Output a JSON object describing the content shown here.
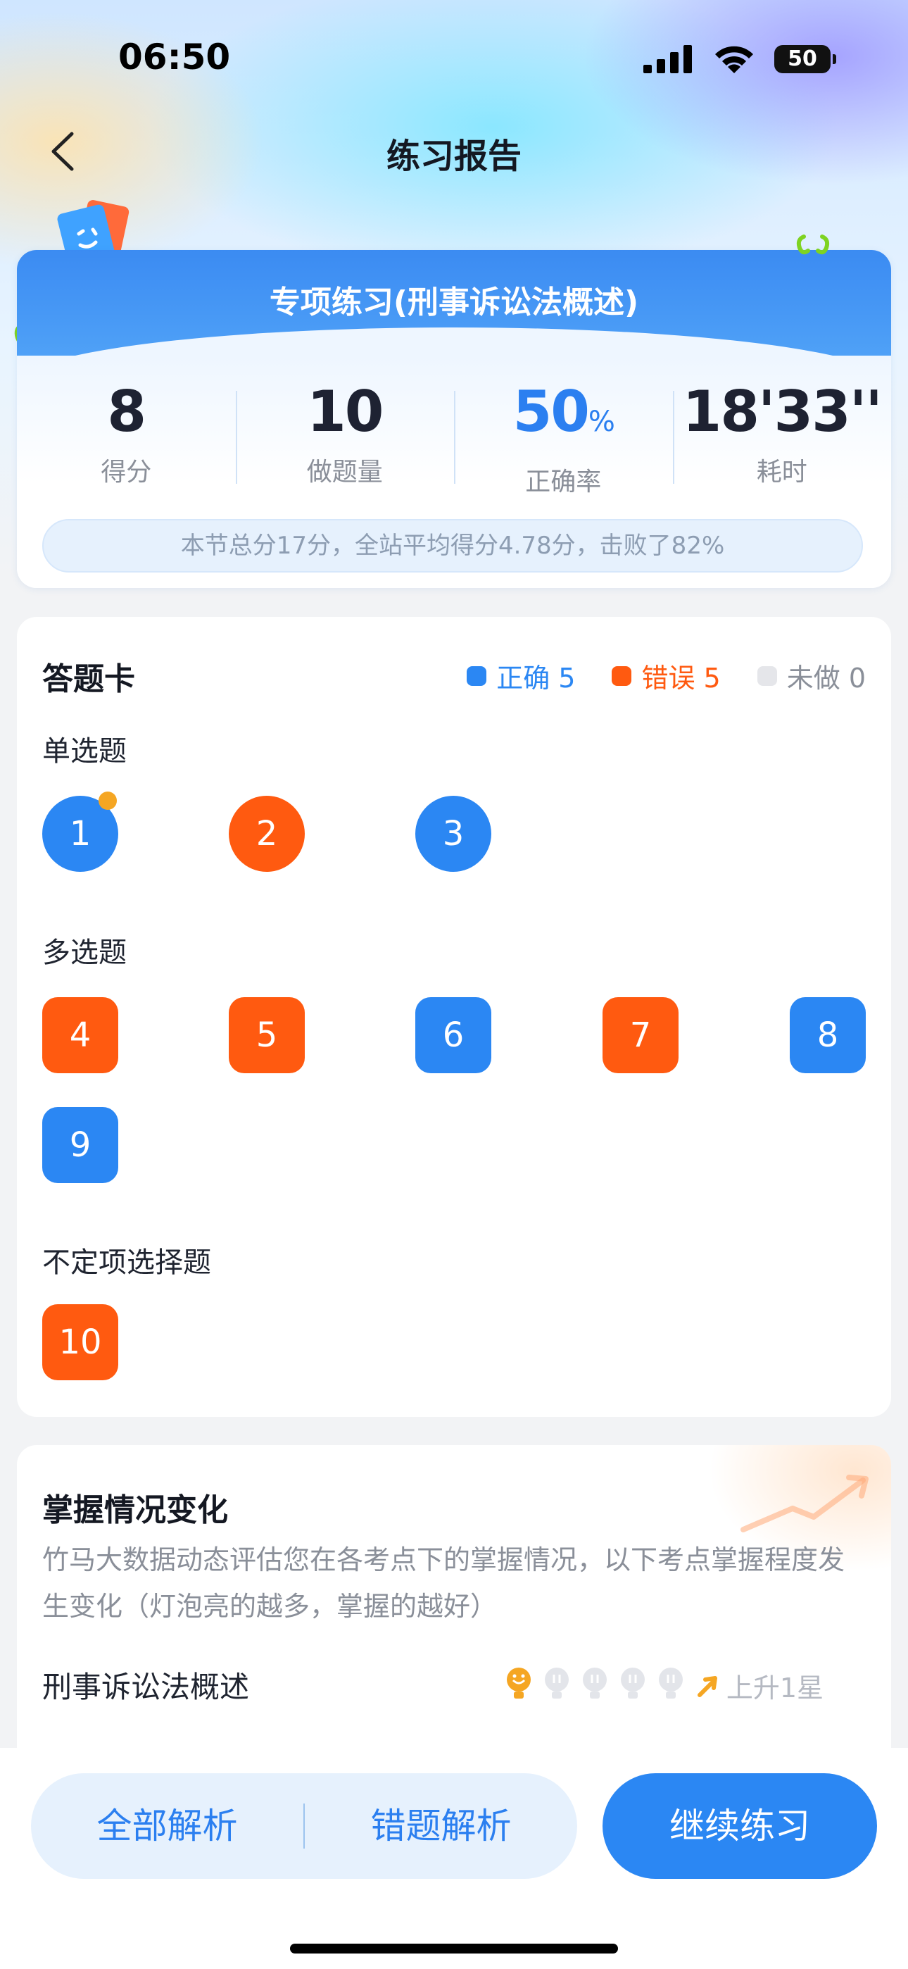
{
  "status_bar": {
    "time": "06:50",
    "battery": "50"
  },
  "nav": {
    "title": "练习报告"
  },
  "summary": {
    "title": "专项练习(刑事诉讼法概述)",
    "stats": [
      {
        "value": "8",
        "unit": "",
        "label": "得分"
      },
      {
        "value": "10",
        "unit": "",
        "label": "做题量"
      },
      {
        "value": "50",
        "unit": "%",
        "label": "正确率"
      },
      {
        "value": "18'33''",
        "unit": "",
        "label": "耗时"
      }
    ],
    "note": "本节总分17分，全站平均得分4.78分，击败了82%"
  },
  "answer_card": {
    "title": "答题卡",
    "legend": [
      {
        "label": "正确 5",
        "color": "#2b87f3"
      },
      {
        "label": "错误 5",
        "color": "#ff5a10"
      },
      {
        "label": "未做 0",
        "color": "#e5e6ea"
      }
    ],
    "sections": [
      {
        "label": "单选题",
        "questions": [
          {
            "num": "1",
            "status": "correct",
            "marked": true
          },
          {
            "num": "2",
            "status": "wrong"
          },
          {
            "num": "3",
            "status": "correct"
          }
        ]
      },
      {
        "label": "多选题",
        "questions": [
          {
            "num": "4",
            "status": "wrong"
          },
          {
            "num": "5",
            "status": "wrong"
          },
          {
            "num": "6",
            "status": "correct"
          },
          {
            "num": "7",
            "status": "wrong"
          },
          {
            "num": "8",
            "status": "correct"
          },
          {
            "num": "9",
            "status": "correct"
          }
        ]
      },
      {
        "label": "不定项选择题",
        "questions": [
          {
            "num": "10",
            "status": "wrong"
          }
        ]
      }
    ]
  },
  "mastery": {
    "title": "掌握情况变化",
    "description": "竹马大数据动态评估您在各考点下的掌握情况，以下考点掌握程度发生变化（灯泡亮的越多，掌握的越好）",
    "items": [
      {
        "topic": "刑事诉讼法概述",
        "lit_bulbs": 1,
        "total_bulbs": 5,
        "trend": "上升1星"
      }
    ]
  },
  "actions": {
    "all_analysis": "全部解析",
    "wrong_analysis": "错题解析",
    "continue": "继续练习"
  },
  "colors": {
    "correct": "#2b87f3",
    "wrong": "#ff5a10",
    "primary": "#2b87f3"
  }
}
